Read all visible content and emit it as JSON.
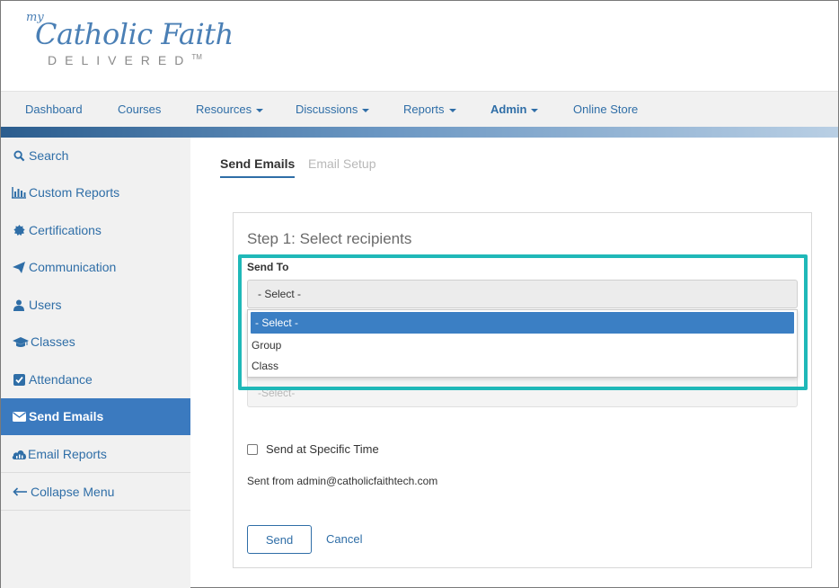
{
  "logo": {
    "my": "my",
    "main": "Catholic Faith",
    "sub": "DELIVERED",
    "tm": "TM"
  },
  "topnav": [
    {
      "label": "Dashboard",
      "caret": false,
      "bold": false
    },
    {
      "label": "Courses",
      "caret": false,
      "bold": false
    },
    {
      "label": "Resources",
      "caret": true,
      "bold": false
    },
    {
      "label": "Discussions",
      "caret": true,
      "bold": false
    },
    {
      "label": "Reports",
      "caret": true,
      "bold": false
    },
    {
      "label": "Admin",
      "caret": true,
      "bold": true
    },
    {
      "label": "Online Store",
      "caret": false,
      "bold": false
    }
  ],
  "sidebar": [
    {
      "label": "Search",
      "icon": "search-icon"
    },
    {
      "label": "Custom Reports",
      "icon": "bar-chart-icon"
    },
    {
      "label": "Certifications",
      "icon": "certificate-icon"
    },
    {
      "label": "Communication",
      "icon": "paper-plane-icon"
    },
    {
      "label": "Users",
      "icon": "user-icon"
    },
    {
      "label": "Classes",
      "icon": "graduation-cap-icon"
    },
    {
      "label": "Attendance",
      "icon": "check-square-icon"
    },
    {
      "label": "Send Emails",
      "icon": "envelope-icon",
      "active": true
    },
    {
      "label": "Email Reports",
      "icon": "cloud-chart-icon"
    },
    {
      "label": "Collapse Menu",
      "icon": "arrow-left-icon"
    }
  ],
  "tabs": {
    "send_emails": "Send Emails",
    "email_setup": "Email Setup"
  },
  "form": {
    "step_title": "Step 1: Select recipients",
    "send_to_label": "Send To",
    "send_to_value": "- Select -",
    "options": [
      "- Select -",
      "Group",
      "Class"
    ],
    "second_select_value": "-Select-",
    "specific_time_label": "Send at Specific Time",
    "sent_from": "Sent from admin@catholicfaithtech.com",
    "send_button": "Send",
    "cancel_link": "Cancel"
  },
  "colors": {
    "accent": "#2f6ea7",
    "active_bg": "#3b7abf",
    "highlight": "#1fb8b8"
  }
}
